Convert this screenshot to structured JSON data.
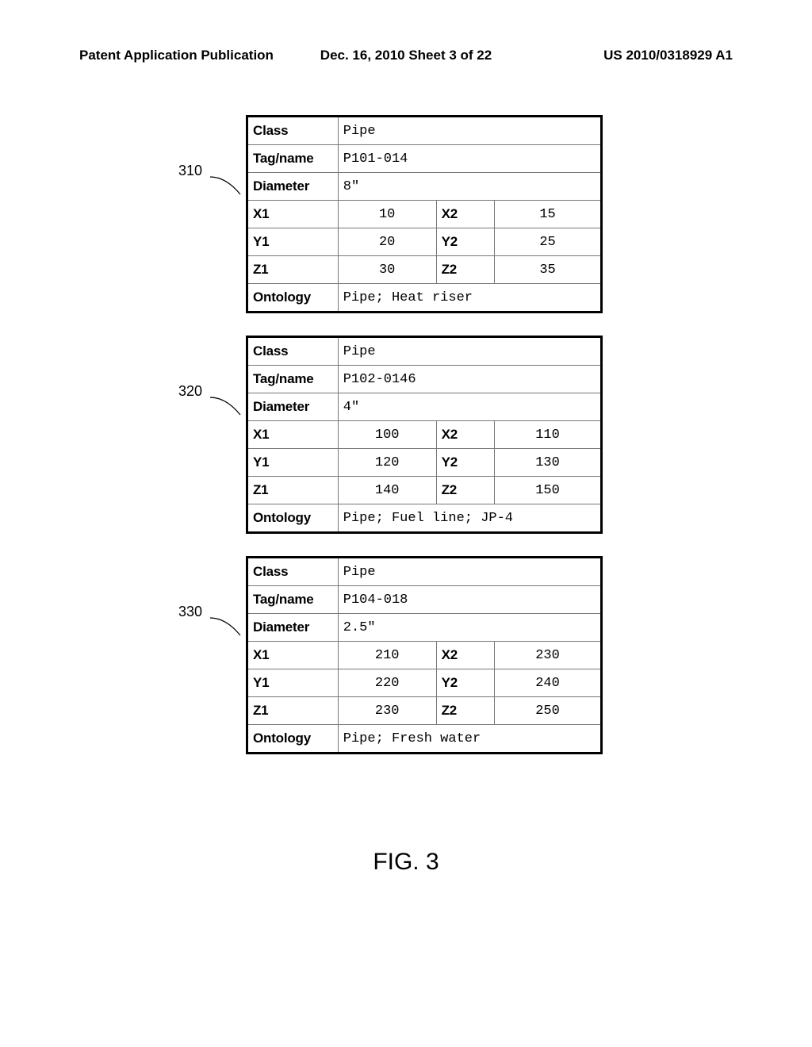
{
  "header": {
    "left": "Patent Application Publication",
    "mid": "Dec. 16, 2010  Sheet 3 of 22",
    "right": "US 2010/0318929 A1"
  },
  "labels": {
    "class": "Class",
    "tagname": "Tag/name",
    "diameter": "Diameter",
    "x1": "X1",
    "x2": "X2",
    "y1": "Y1",
    "y2": "Y2",
    "z1": "Z1",
    "z2": "Z2",
    "ontology": "Ontology"
  },
  "tables": [
    {
      "ref": "310",
      "class_val": "Pipe",
      "tagname": "P101-014",
      "diameter": "8\"",
      "x1": "10",
      "x2": "15",
      "y1": "20",
      "y2": "25",
      "z1": "30",
      "z2": "35",
      "ontology": "Pipe; Heat riser"
    },
    {
      "ref": "320",
      "class_val": "Pipe",
      "tagname": "P102-0146",
      "diameter": "4\"",
      "x1": "100",
      "x2": "110",
      "y1": "120",
      "y2": "130",
      "z1": "140",
      "z2": "150",
      "ontology": "Pipe; Fuel line; JP-4"
    },
    {
      "ref": "330",
      "class_val": "Pipe",
      "tagname": "P104-018",
      "diameter": "2.5\"",
      "x1": "210",
      "x2": "230",
      "y1": "220",
      "y2": "240",
      "z1": "230",
      "z2": "250",
      "ontology": "Pipe; Fresh water"
    }
  ],
  "figure_caption": "FIG. 3"
}
